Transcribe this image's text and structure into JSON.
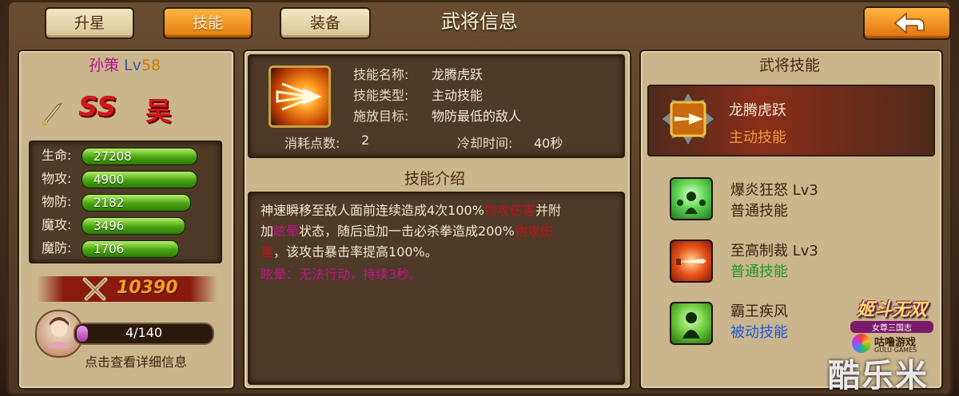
{
  "tabs": {
    "star": "升星",
    "skill": "技能",
    "equip": "装备"
  },
  "page_title": "武将信息",
  "hero": {
    "name": "孙策",
    "lv_prefix": "Lv",
    "level": "58",
    "rank": "SS",
    "faction": "吴",
    "power": "10390"
  },
  "stats": [
    {
      "label": "生命:",
      "value": "27208",
      "fill": 0.95
    },
    {
      "label": "物攻:",
      "value": "4900",
      "fill": 0.95
    },
    {
      "label": "物防:",
      "value": "2182",
      "fill": 0.9
    },
    {
      "label": "魔攻:",
      "value": "3496",
      "fill": 0.85
    },
    {
      "label": "魔防:",
      "value": "1706",
      "fill": 0.8
    }
  ],
  "exp": {
    "text": "4/140",
    "fraction": 0.028
  },
  "detail_link": "点击查看详细信息",
  "skill_detail": {
    "name_label": "技能名称:",
    "name": "龙腾虎跃",
    "type_label": "技能类型:",
    "type": "主动技能",
    "target_label": "施放目标:",
    "target": "物防最低的敌人",
    "cost_label": "消耗点数:",
    "cost": "2",
    "cd_label": "冷却时间:",
    "cd": "40秒"
  },
  "intro": {
    "header": "技能介绍",
    "l1a": "神速瞬移至敌人面前连续造成4次100%",
    "l1b": "物攻伤害",
    "l1c": "并附",
    "l2a": "加",
    "l2b": "眩晕",
    "l2c": "状态，随后追加一击必杀拳造成200%",
    "l2d": "物攻伤",
    "l3a": "害",
    "l3b": "，该攻击暴击率提高100%。",
    "l4": "眩晕：无法行动，持续3秒。"
  },
  "hero_skills": {
    "header": "武将技能",
    "main": {
      "name": "龙腾虎跃",
      "type": "主动技能"
    },
    "list": [
      {
        "name": "爆炎狂怒 Lv3",
        "type": "普通技能"
      },
      {
        "name": "至高制裁 Lv3",
        "type": "普通技能"
      },
      {
        "name": "霸王疾风",
        "type": "被动技能"
      }
    ]
  },
  "logo": {
    "title": "姬斗无双",
    "sub": "女尊三国志",
    "brand": "咕噜游戏",
    "brand_en": "GULU GAMES"
  },
  "watermark": "酷乐米",
  "colors": {
    "active_tab": "#f08a1c",
    "stat_bar": "#48a410",
    "red_text": "#c0141c",
    "magenta_text": "#b0148a",
    "green_text": "#1e9a1e",
    "blue_text": "#1c5ad8"
  }
}
